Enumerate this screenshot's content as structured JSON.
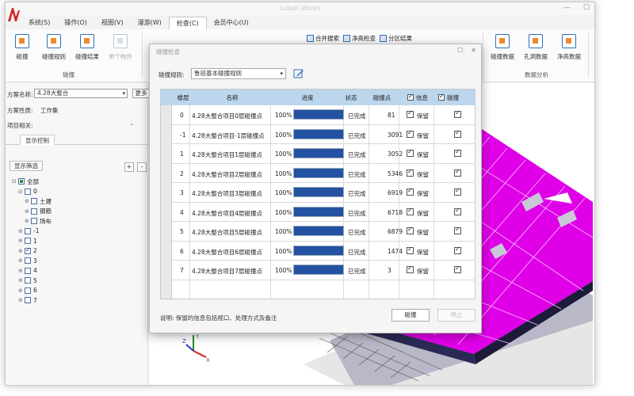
{
  "app": {
    "title": "Luban Works",
    "menu": [
      "系统(S)",
      "操作(O)",
      "视图(V)",
      "漫游(W)",
      "检查(C)",
      "会员中心(U)"
    ],
    "active_menu_index": 4
  },
  "ribbon": {
    "buttons": [
      "碰撞",
      "碰撞规则",
      "碰撞结果",
      "单个构件"
    ],
    "group_collision": "碰撞",
    "small_buttons": [
      "合并搜索",
      "净高检查",
      "分区结果"
    ],
    "right_buttons": [
      "碰撞数据",
      "孔洞数据",
      "净高数据"
    ],
    "group_data": "数据分析"
  },
  "left_panel": {
    "plan_label": "方案名称:",
    "plan_value": "4.28大整合",
    "more_label": "更多",
    "property_label": "方案性质:",
    "property_value": "工作集",
    "related_label": "项目相关:",
    "tab": "显示控制",
    "filter_label": "显示筛选",
    "plus": "+",
    "minus": "-",
    "tree": [
      {
        "label": "全部",
        "level": 0,
        "exp": "⊟",
        "state": "partial"
      },
      {
        "label": "0",
        "level": 1,
        "exp": "⊟",
        "state": "none"
      },
      {
        "label": "土建",
        "level": 2,
        "exp": "⊕",
        "state": "none"
      },
      {
        "label": "钢筋",
        "level": 2,
        "exp": "⊕",
        "state": "none"
      },
      {
        "label": "场布",
        "level": 2,
        "exp": "⊕",
        "state": "none"
      },
      {
        "label": "-1",
        "level": 1,
        "exp": "⊕",
        "state": "none"
      },
      {
        "label": "1",
        "level": 1,
        "exp": "⊕",
        "state": "none"
      },
      {
        "label": "2",
        "level": 1,
        "exp": "⊕",
        "state": "checked"
      },
      {
        "label": "3",
        "level": 1,
        "exp": "⊕",
        "state": "none"
      },
      {
        "label": "4",
        "level": 1,
        "exp": "⊕",
        "state": "none"
      },
      {
        "label": "5",
        "level": 1,
        "exp": "⊕",
        "state": "none"
      },
      {
        "label": "6",
        "level": 1,
        "exp": "⊕",
        "state": "none"
      },
      {
        "label": "7",
        "level": 1,
        "exp": "⊕",
        "state": "none"
      }
    ]
  },
  "viewport": {
    "model_color": "#e000e8",
    "axes": {
      "x": "X",
      "y": "Y",
      "z": "Z"
    }
  },
  "dialog": {
    "title": "碰撞检查",
    "rule_label": "碰撞规则:",
    "rule_value": "鲁班基本碰撞规则",
    "headers": {
      "floor": "楼层",
      "name": "名称",
      "progress": "进度",
      "status": "状态",
      "points": "碰撞点",
      "info": "信息",
      "collision": "碰撞"
    },
    "rows": [
      {
        "floor": "0",
        "name": "4.28大整合项目0层碰撞点",
        "progress": 100,
        "progress_text": "100%",
        "status": "已完成",
        "points": "81",
        "keep": "保留"
      },
      {
        "floor": "-1",
        "name": "4.28大整合项目-1层碰撞点",
        "progress": 100,
        "progress_text": "100%",
        "status": "已完成",
        "points": "3091",
        "keep": "保留"
      },
      {
        "floor": "1",
        "name": "4.28大整合项目1层碰撞点",
        "progress": 100,
        "progress_text": "100%",
        "status": "已完成",
        "points": "3052",
        "keep": "保留"
      },
      {
        "floor": "2",
        "name": "4.28大整合项目2层碰撞点",
        "progress": 100,
        "progress_text": "100%",
        "status": "已完成",
        "points": "5346",
        "keep": "保留"
      },
      {
        "floor": "3",
        "name": "4.28大整合项目3层碰撞点",
        "progress": 100,
        "progress_text": "100%",
        "status": "已完成",
        "points": "6919",
        "keep": "保留"
      },
      {
        "floor": "4",
        "name": "4.28大整合项目4层碰撞点",
        "progress": 100,
        "progress_text": "100%",
        "status": "已完成",
        "points": "6718",
        "keep": "保留"
      },
      {
        "floor": "5",
        "name": "4.28大整合项目5层碰撞点",
        "progress": 100,
        "progress_text": "100%",
        "status": "已完成",
        "points": "6879",
        "keep": "保留"
      },
      {
        "floor": "6",
        "name": "4.28大整合项目6层碰撞点",
        "progress": 100,
        "progress_text": "100%",
        "status": "已完成",
        "points": "1474",
        "keep": "保留"
      },
      {
        "floor": "7",
        "name": "4.28大整合项目7层碰撞点",
        "progress": 100,
        "progress_text": "100%",
        "status": "已完成",
        "points": "3",
        "keep": "保留"
      }
    ],
    "note": "说明: 保留的信息包括视口、处理方式及备注",
    "collide_button": "碰撞",
    "stop_button": "停止"
  }
}
